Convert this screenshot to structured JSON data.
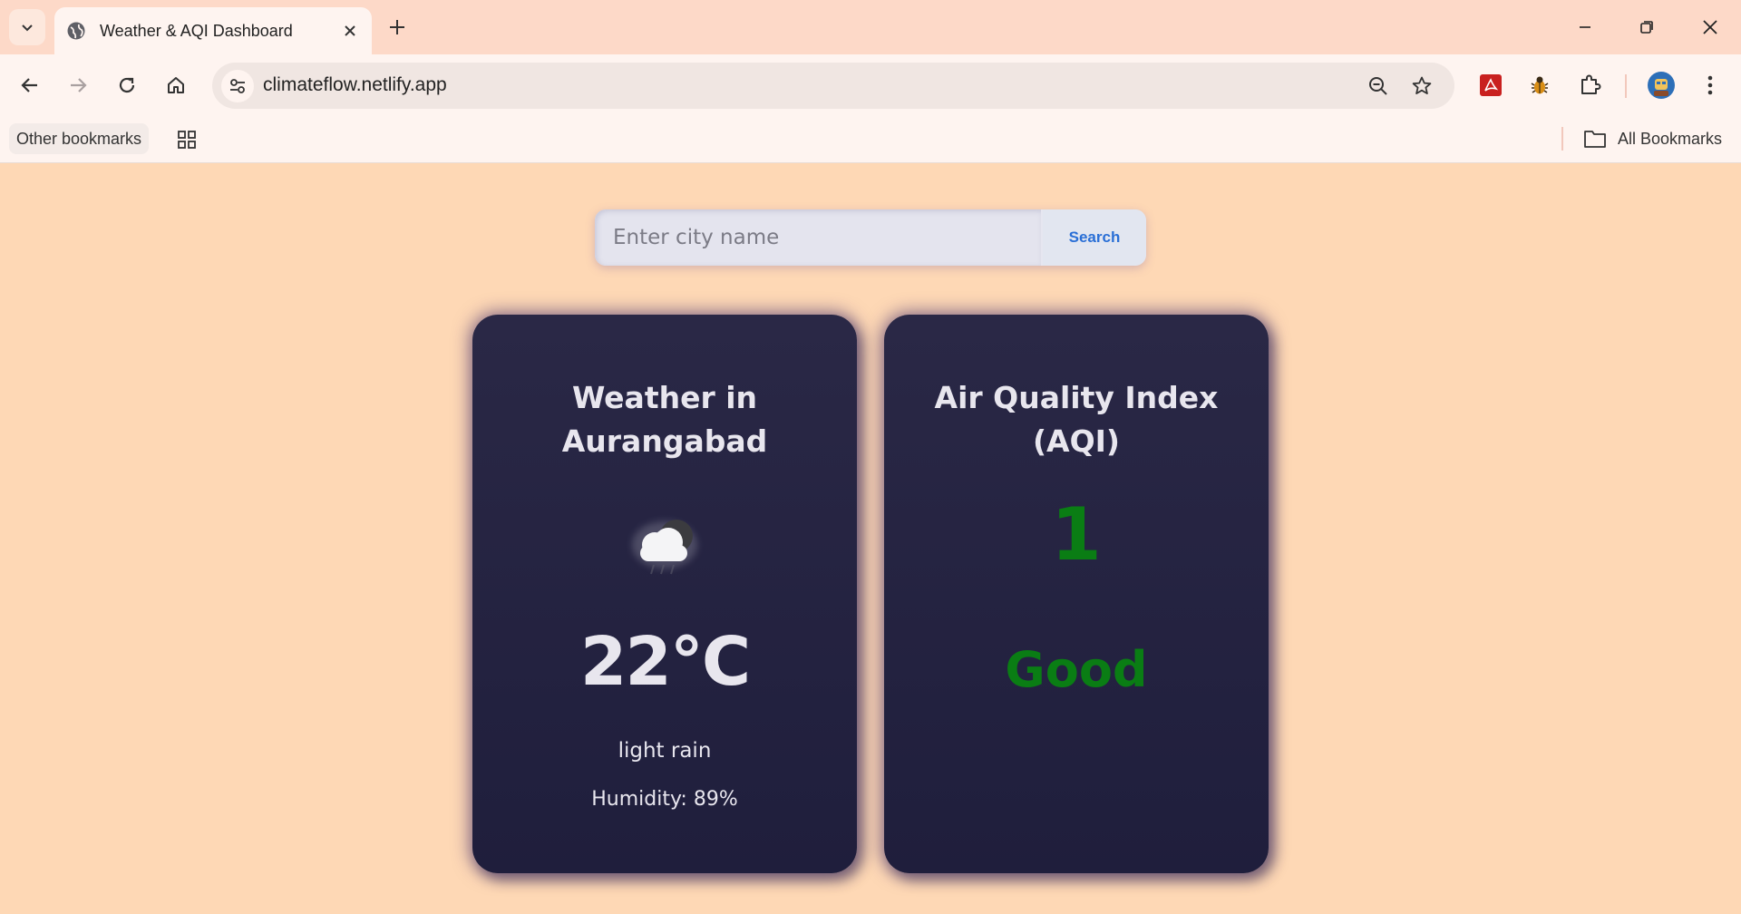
{
  "browser": {
    "tab_title": "Weather & AQI Dashboard",
    "url": "climateflow.netlify.app",
    "bookmarks": {
      "other_label": "Other bookmarks",
      "all_label": "All Bookmarks"
    }
  },
  "search": {
    "placeholder": "Enter city name",
    "value": "",
    "button_label": "Search"
  },
  "weather": {
    "title": "Weather in Aurangabad",
    "icon": "cloud-rain-night-icon",
    "temperature": "22°C",
    "description": "light rain",
    "humidity": "Humidity: 89%"
  },
  "aqi": {
    "title": "Air Quality Index (AQI)",
    "value": "1",
    "label": "Good",
    "status_color": "#0a7d14"
  },
  "colors": {
    "page_background": "#fed8b5",
    "card_background": "#23223f",
    "card_text": "#e8e6ee",
    "search_button_text": "#2a6fd6"
  }
}
